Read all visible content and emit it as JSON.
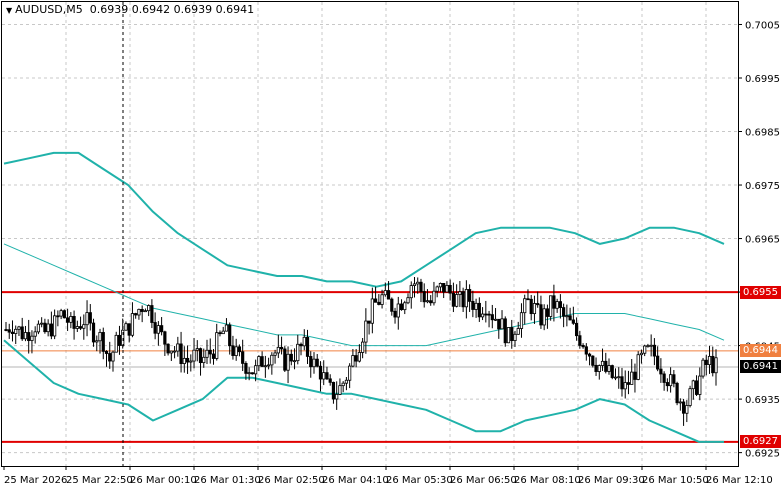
{
  "header": {
    "symbol_timeframe": "AUDUSD,M5",
    "ohlc": "0.6939 0.6942 0.6939 0.6941"
  },
  "price_tags": {
    "upper_line": "0.6955",
    "orange_line": "0.6944",
    "current": "0.6941",
    "lower_line": "0.6927"
  },
  "colors": {
    "background": "#ffffff",
    "grid": "#c8c8c8",
    "candles": "#000000",
    "bollinger": "#20b2aa",
    "support_resistance": "#e00000",
    "orange_line": "#f08040",
    "current_price_line": "#b4b4b4"
  },
  "chart_data": {
    "type": "candlestick",
    "symbol": "AUDUSD",
    "timeframe": "M5",
    "y_ticks": [
      "0.7005",
      "0.6995",
      "0.6985",
      "0.6975",
      "0.6965",
      "0.6955",
      "0.6945",
      "0.6935",
      "0.6925"
    ],
    "x_ticks": [
      "25 Mar 2026",
      "25 Mar 22:50",
      "26 Mar 00:10",
      "26 Mar 01:30",
      "26 Mar 02:50",
      "26 Mar 04:10",
      "26 Mar 05:30",
      "26 Mar 06:50",
      "26 Mar 08:10",
      "26 Mar 09:30",
      "26 Mar 10:50",
      "26 Mar 12:10"
    ],
    "ylim": [
      0.69225,
      0.70092
    ],
    "horizontal_lines": {
      "resistance": 0.6955,
      "orange": 0.6944,
      "current_price": 0.6941,
      "support": 0.6927
    },
    "vertical_marker_time": "25 Mar 22:50",
    "close_path": [
      0.6948,
      0.6949,
      0.6948,
      0.6947,
      0.6948,
      0.6949,
      0.6947,
      0.6948,
      0.6949,
      0.6951,
      0.695,
      0.6948,
      0.6949,
      0.695,
      0.6948,
      0.6947,
      0.6946,
      0.6942,
      0.6945,
      0.6947,
      0.6948,
      0.695,
      0.6952,
      0.6953,
      0.6951,
      0.6948,
      0.6946,
      0.6945,
      0.6944,
      0.6943,
      0.6942,
      0.6943,
      0.6942,
      0.6943,
      0.6944,
      0.6946,
      0.6948,
      0.6945,
      0.6943,
      0.6942,
      0.6941,
      0.694,
      0.6942,
      0.6943,
      0.6944,
      0.6943,
      0.6942,
      0.6943,
      0.6944,
      0.6945,
      0.6943,
      0.6941,
      0.694,
      0.6937,
      0.6936,
      0.6937,
      0.6939,
      0.6942,
      0.6945,
      0.6948,
      0.6951,
      0.6953,
      0.6954,
      0.6953,
      0.6952,
      0.6953,
      0.6955,
      0.6957,
      0.6956,
      0.6954,
      0.6953,
      0.6955,
      0.6956,
      0.6955,
      0.6954,
      0.6953,
      0.6954,
      0.6953,
      0.6952,
      0.6953,
      0.6951,
      0.695,
      0.6948,
      0.6946,
      0.6949,
      0.6951,
      0.6953,
      0.6952,
      0.695,
      0.6951,
      0.6953,
      0.6952,
      0.695,
      0.6949,
      0.6947,
      0.6946,
      0.6944,
      0.6942,
      0.6941,
      0.694,
      0.6939,
      0.6938,
      0.6937,
      0.6939,
      0.6941,
      0.6943,
      0.6944,
      0.6943,
      0.6941,
      0.6939,
      0.6937,
      0.6935,
      0.6934,
      0.6936,
      0.6938,
      0.6941,
      0.6942,
      0.6941
    ],
    "bollinger": {
      "upper_path": [
        0.6979,
        0.698,
        0.6981,
        0.6981,
        0.6978,
        0.6975,
        0.697,
        0.6966,
        0.6963,
        0.696,
        0.6959,
        0.6958,
        0.6958,
        0.6957,
        0.6957,
        0.6956,
        0.6957,
        0.696,
        0.6963,
        0.6966,
        0.6967,
        0.6967,
        0.6967,
        0.6966,
        0.6964,
        0.6965,
        0.6967,
        0.6967,
        0.6966,
        0.6964
      ],
      "middle_path": [
        0.6964,
        0.6962,
        0.696,
        0.6958,
        0.6956,
        0.6954,
        0.6952,
        0.6951,
        0.695,
        0.6949,
        0.6948,
        0.6947,
        0.6947,
        0.6946,
        0.6945,
        0.6945,
        0.6945,
        0.6945,
        0.6946,
        0.6947,
        0.6948,
        0.6949,
        0.695,
        0.6951,
        0.6951,
        0.6951,
        0.695,
        0.6949,
        0.6948,
        0.6946
      ],
      "lower_path": [
        0.6946,
        0.6942,
        0.6938,
        0.6936,
        0.6935,
        0.6934,
        0.6931,
        0.6933,
        0.6935,
        0.6939,
        0.6939,
        0.6938,
        0.6937,
        0.6936,
        0.6936,
        0.6935,
        0.6934,
        0.6933,
        0.6931,
        0.6929,
        0.6929,
        0.6931,
        0.6932,
        0.6933,
        0.6935,
        0.6934,
        0.6931,
        0.6929,
        0.6927,
        0.6927
      ]
    }
  }
}
